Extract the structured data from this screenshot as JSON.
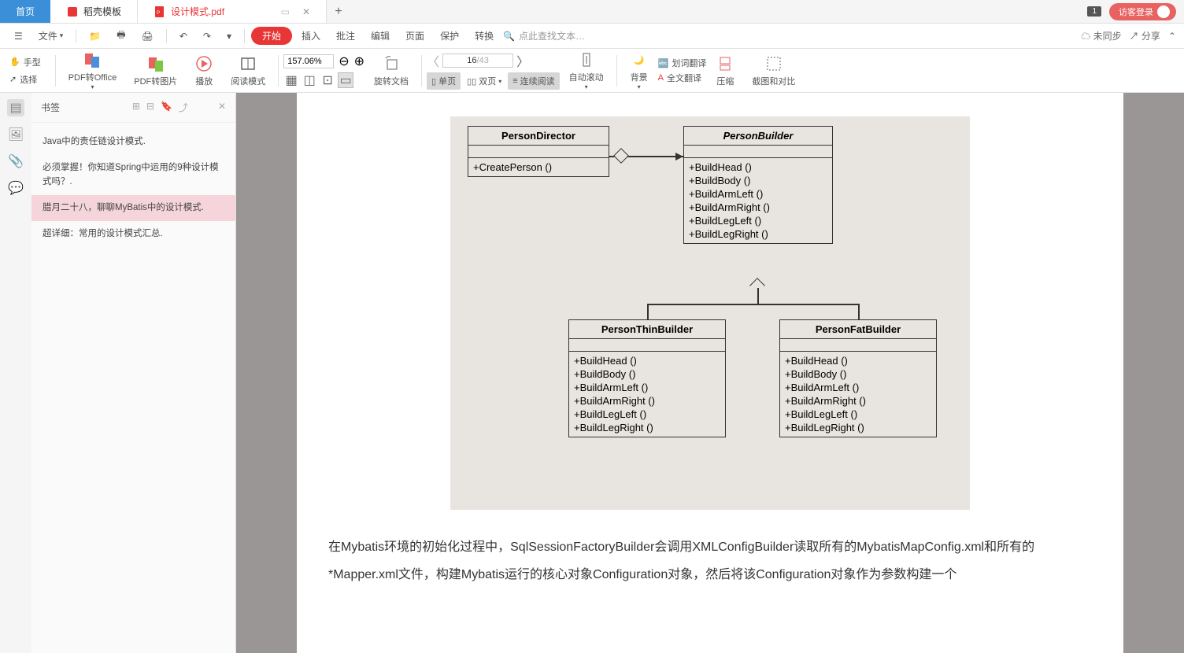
{
  "tabs": {
    "home": "首页",
    "template": "稻壳模板",
    "active_file": "设计模式.pdf"
  },
  "top_right": {
    "badge": "1",
    "login": "访客登录"
  },
  "menu": {
    "file": "文件",
    "start": "开始",
    "insert": "插入",
    "annotate": "批注",
    "edit": "编辑",
    "page": "页面",
    "protect": "保护",
    "convert": "转换",
    "search_placeholder": "点此查找文本…",
    "not_synced": "未同步",
    "share": "分享"
  },
  "ribbon": {
    "hand": "手型",
    "select": "选择",
    "pdf_to_office": "PDF转Office",
    "pdf_to_image": "PDF转图片",
    "play": "播放",
    "read_mode": "阅读模式",
    "zoom_value": "157.06%",
    "rotate": "旋转文档",
    "single_page": "单页",
    "double_page": "双页",
    "continuous": "连续阅读",
    "page_current": "16",
    "page_sep": "/",
    "page_total": "43",
    "auto_scroll": "自动滚动",
    "background": "背景",
    "word_translate": "划词翻译",
    "full_translate": "全文翻译",
    "compress": "压缩",
    "crop_compare": "截图和对比"
  },
  "sidebar": {
    "title": "书签",
    "items": [
      "Java中的责任链设计模式.",
      "必须掌握！你知道Spring中运用的9种设计模式吗？.",
      "腊月二十八，聊聊MyBatis中的设计模式.",
      "超详细：常用的设计模式汇总."
    ],
    "active_index": 2
  },
  "uml": {
    "director": {
      "name": "PersonDirector",
      "methods": [
        "+CreatePerson ()"
      ]
    },
    "builder": {
      "name": "PersonBuilder",
      "methods": [
        "+BuildHead ()",
        "+BuildBody ()",
        "+BuildArmLeft ()",
        "+BuildArmRight ()",
        "+BuildLegLeft ()",
        "+BuildLegRight ()"
      ]
    },
    "thin": {
      "name": "PersonThinBuilder",
      "methods": [
        "+BuildHead ()",
        "+BuildBody ()",
        "+BuildArmLeft ()",
        "+BuildArmRight ()",
        "+BuildLegLeft ()",
        "+BuildLegRight ()"
      ]
    },
    "fat": {
      "name": "PersonFatBuilder",
      "methods": [
        "+BuildHead ()",
        "+BuildBody ()",
        "+BuildArmLeft ()",
        "+BuildArmRight ()",
        "+BuildLegLeft ()",
        "+BuildLegRight ()"
      ]
    }
  },
  "doc_text": "在Mybatis环境的初始化过程中，SqlSessionFactoryBuilder会调用XMLConfigBuilder读取所有的MybatisMapConfig.xml和所有的*Mapper.xml文件，构建Mybatis运行的核心对象Configuration对象，然后将该Configuration对象作为参数构建一个"
}
